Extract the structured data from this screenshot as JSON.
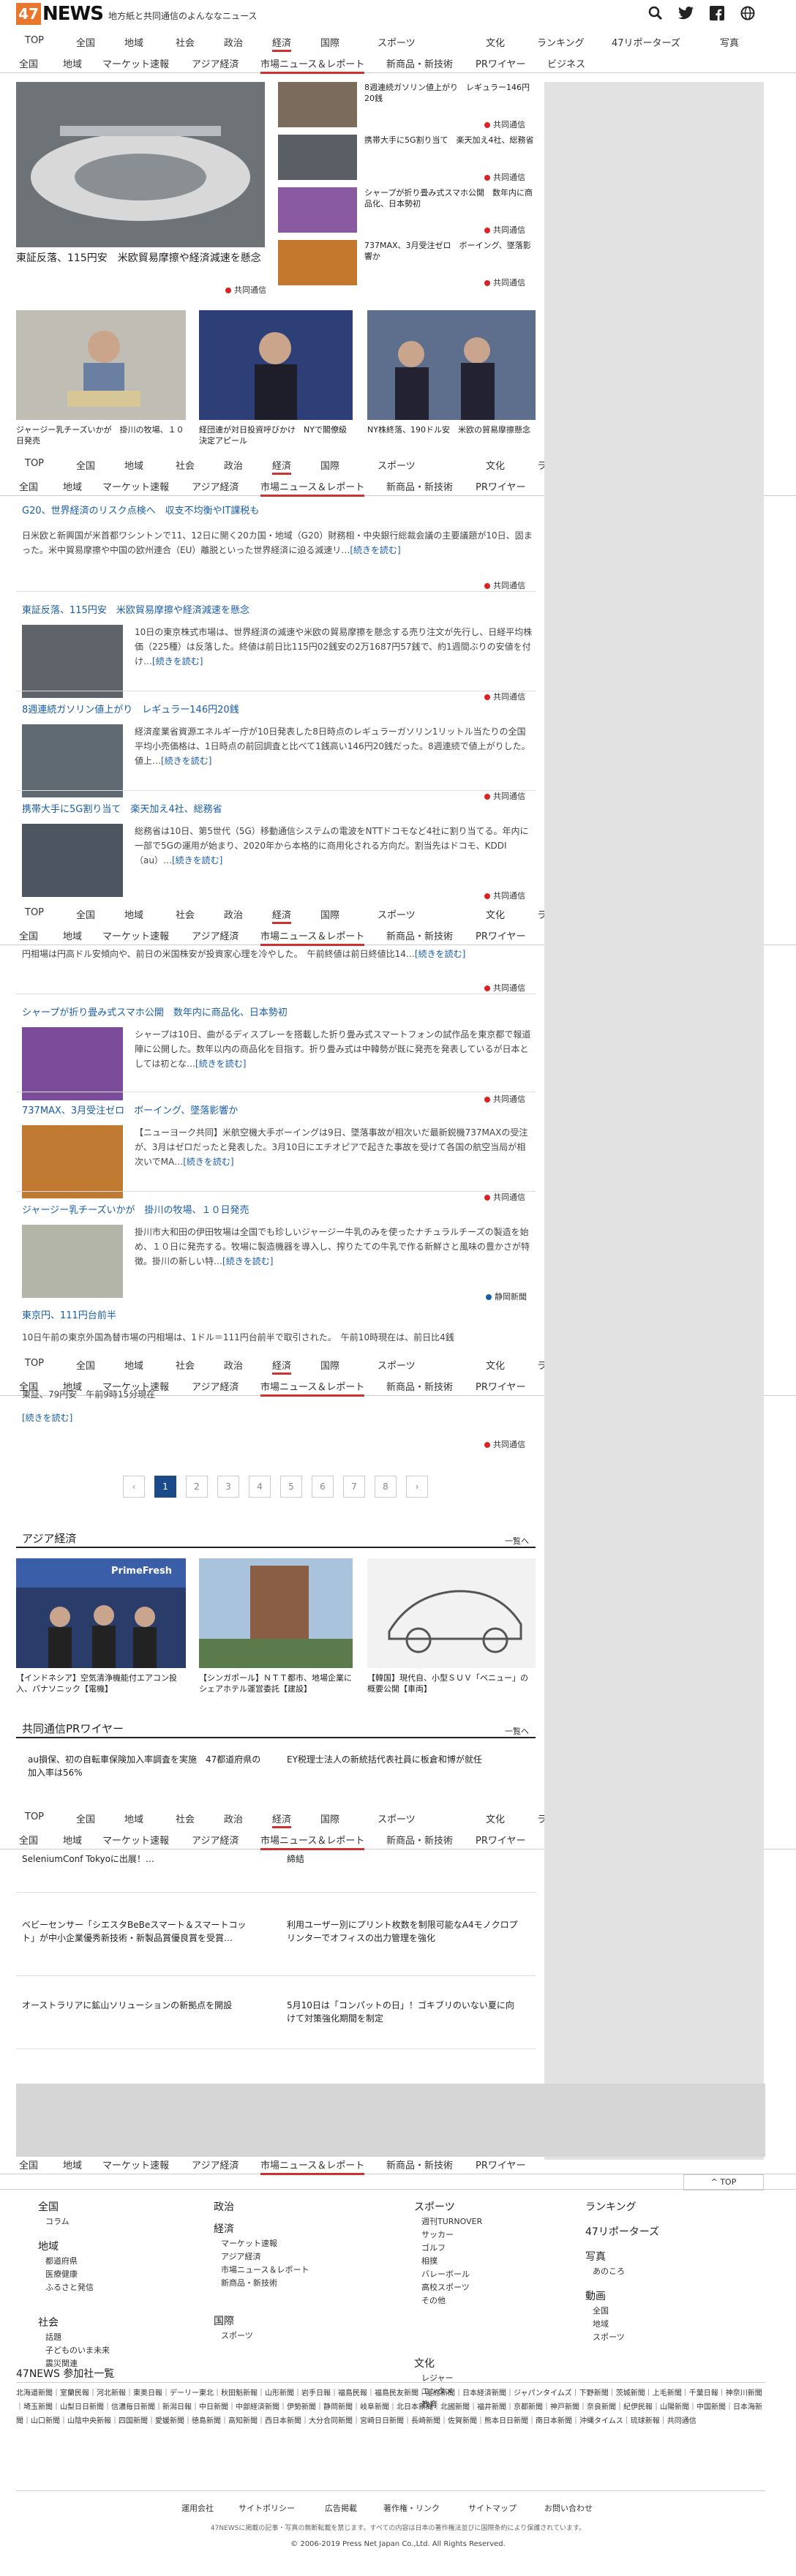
{
  "header": {
    "logo_mark": "47",
    "logo_text": "NEWS",
    "tagline": "地方紙と共同通信のよんななニュース"
  },
  "nav_main": [
    "TOP",
    "全国",
    "地域",
    "社会",
    "政治",
    "経済",
    "国際",
    "スポーツ",
    "文化",
    "ランキング",
    "47リポーターズ",
    "写真"
  ],
  "nav_sub": [
    "全国",
    "地域",
    "マーケット速報",
    "アジア経済",
    "市場ニュース＆レポート",
    "新商品・新技術",
    "PRワイヤー",
    "ビジネス"
  ],
  "hero": {
    "caption": "東証反落、115円安　米欧貿易摩擦や経済減速を懸念",
    "source": "共同通信"
  },
  "side_news": [
    {
      "title": "8週連続ガソリン値上がり　レギュラー146円20銭",
      "source": "共同通信"
    },
    {
      "title": "携帯大手に5G割り当て　楽天加え4社、総務省",
      "source": "共同通信"
    },
    {
      "title": "シャープが折り畳み式スマホ公開　数年内に商品化、日本勢初",
      "source": "共同通信"
    },
    {
      "title": "737MAX、3月受注ゼロ　ボーイング、墜落影響か",
      "source": "共同通信"
    }
  ],
  "photo_row": [
    {
      "caption": "ジャージー乳チーズいかが　掛川の牧場、１０日発売"
    },
    {
      "caption": "経団連が対日投資呼びかけ　NYで閣僚級決定アピール"
    },
    {
      "caption": "NY株終落、190ドル安　米欧の貿易摩擦懸念"
    }
  ],
  "lead": {
    "title": "G20、世界経済のリスク点検へ　収支不均衡やIT課税も",
    "body": "日米欧と新興国が米首都ワシントンで11、12日に開く20カ国・地域（G20）財務相・中央銀行総裁会議の主要議題が10日、固まった。米中貿易摩擦や中国の欧州連合（EU）離脱といった世界経済に迫る減速リ…",
    "more": "[続きを読む]",
    "source": "共同通信"
  },
  "articles": [
    {
      "title": "東証反落、115円安　米欧貿易摩擦や経済減速を懸念",
      "body": "10日の東京株式市場は、世界経済の減速や米欧の貿易摩擦を懸念する売り注文が先行し、日経平均株価（225種）は反落した。終値は前日比115円02銭安の2万1687円57銭で、約1週間ぶりの安値を付け…",
      "more": "[続きを読む]",
      "source": "共同通信"
    },
    {
      "title": "8週連続ガソリン値上がり　レギュラー146円20銭",
      "body": "経済産業省資源エネルギー庁が10日発表した8日時点のレギュラーガソリン1リットル当たりの全国平均小売価格は、1日時点の前回調査と比べて1銭高い146円20銭だった。8週連続で値上がりした。値上…",
      "more": "[続きを読む]",
      "source": "共同通信"
    },
    {
      "title": "携帯大手に5G割り当て　楽天加え4社、総務省",
      "body": "総務省は10日、第5世代（5G）移動通信システムの電波をNTTドコモなど4社に割り当てる。年内に一部で5Gの運用が始まり、2020年から本格的に商用化される方向だ。割当先はドコモ、KDDI（au）…",
      "more": "[続きを読む]",
      "source": "共同通信"
    }
  ],
  "partial_top": {
    "body": "円相場は円高ドル安傾向や、前日の米国株安が投資家心理を冷やした。　午前終値は前日終値比14…",
    "more": "[続きを読む]",
    "source": "共同通信"
  },
  "articles2": [
    {
      "title": "シャープが折り畳み式スマホ公開　数年内に商品化、日本勢初",
      "body": "シャープは10日、曲がるディスプレーを搭載した折り畳み式スマートフォンの試作品を東京都で報道陣に公開した。数年以内の商品化を目指す。折り畳み式は中韓勢が既に発売を発表しているが日本としては初とな…",
      "more": "[続きを読む]",
      "source": "共同通信"
    },
    {
      "title": "737MAX、3月受注ゼロ　ボーイング、墜落影響か",
      "body": "【ニューヨーク共同】米航空機大手ボーイングは9日、墜落事故が相次いだ最新鋭機737MAXの受注が、3月はゼロだったと発表した。3月10日にエチオピアで起きた事故を受けて各国の航空当局が相次いでMA…",
      "more": "[続きを読む]",
      "source": "共同通信"
    },
    {
      "title": "ジャージー乳チーズいかが　掛川の牧場、１０日発売",
      "body": "掛川市大和田の伊田牧場は全国でも珍しいジャージー牛乳のみを使ったナチュラルチーズの製造を始め、１０日に発売する。牧場に製造機器を導入し、搾りたての牛乳で作る新鮮さと風味の豊かさが特徴。掛川の新しい特…",
      "more": "[続きを読む]",
      "source": "静岡新聞"
    }
  ],
  "last_article": {
    "title": "東京円、111円台前半",
    "body": "10日午前の東京外国為替市場の円相場は、1ドル＝111円台前半で取引された。　午前10時現在は、前日比4銭",
    "partial": "東証、79円安　午前9時15分現在",
    "more": "[続きを読む]",
    "source": "共同通信"
  },
  "pagination": [
    "‹",
    "1",
    "2",
    "3",
    "4",
    "5",
    "6",
    "7",
    "8",
    "›"
  ],
  "asia": {
    "heading": "アジア経済",
    "list_link": "一覧へ",
    "items": [
      {
        "caption": "【インドネシア】空気清浄機能付エアコン投入、パナソニック【電機】"
      },
      {
        "caption": "【シンガポール】ＮＴＴ都市、地場企業にシェアホテル運営委託【建設】"
      },
      {
        "caption": "【韓国】現代自、小型ＳＵＶ「ベニュー」の概要公開【車両】"
      }
    ],
    "thumb_label": "PrimeFresh"
  },
  "pr": {
    "heading": "共同通信PRワイヤー",
    "list_link": "一覧へ",
    "items": [
      "au損保、初の自転車保険加入率調査を実施　47都道府県の加入率は56%",
      "EY税理士法人の新統括代表社員に板倉和博が就任",
      "SeleniumConf Tokyoに出展！…",
      "締結",
      "ベビーセンサー「シエスタBeBeスマート＆スマートコット」が中小企業優秀新技術・新製品賞優良賞を受賞…",
      "利用ユーザー別にプリント枚数を制限可能なA4モノクロプリンターでオフィスの出力管理を強化",
      "オーストラリアに鉱山ソリューションの新拠点を開設",
      "5月10日は「コンパットの日」！ゴキブリのいない夏に向けて対策強化期間を制定"
    ]
  },
  "top_link": "^ TOP",
  "footer": {
    "cols": [
      {
        "head": "全国",
        "items": [
          "コラム"
        ]
      },
      {
        "head": "地域",
        "items": [
          "都道府県",
          "医療健康",
          "ふるさと発信"
        ]
      },
      {
        "head": "社会",
        "items": [
          "話題",
          "子どものいま未来",
          "震災関連"
        ]
      },
      {
        "head": "政治",
        "items": []
      },
      {
        "head": "経済",
        "items": [
          "マーケット速報",
          "アジア経済",
          "市場ニュース＆レポート",
          "新商品・新技術"
        ]
      },
      {
        "head": "国際",
        "items": [
          "スポーツ"
        ]
      },
      {
        "head": "スポーツ",
        "items": [
          "週刊TURNOVER",
          "サッカー",
          "ゴルフ",
          "相撲",
          "バレーボール",
          "高校スポーツ",
          "その他"
        ]
      },
      {
        "head": "文化",
        "items": [
          "レジャー",
          "エンタメ",
          "教育"
        ]
      },
      {
        "head": "ランキング",
        "items": []
      },
      {
        "head": "47リポーターズ",
        "items": []
      },
      {
        "head": "写真",
        "items": [
          "あのころ"
        ]
      },
      {
        "head": "動画",
        "items": [
          "全国",
          "地域",
          "スポーツ"
        ]
      }
    ],
    "members_title": "47NEWS 参加社一覧",
    "members": "北海道新聞｜室蘭民報｜河北新報｜東奥日報｜デーリー東北｜秋田魁新報｜山形新聞｜岩手日報｜福島民報｜福島民友新聞｜産経新聞｜日本経済新聞｜ジャパンタイムズ｜下野新聞｜茨城新聞｜上毛新聞｜千葉日報｜神奈川新聞｜埼玉新聞｜山梨日日新聞｜信濃毎日新聞｜新潟日報｜中日新聞｜中部経済新聞｜伊勢新聞｜静岡新聞｜岐阜新聞｜北日本新聞｜北國新聞｜福井新聞｜京都新聞｜神戸新聞｜奈良新聞｜紀伊民報｜山陽新聞｜中国新聞｜日本海新聞｜山口新聞｜山陰中央新報｜四国新聞｜愛媛新聞｜徳島新聞｜高知新聞｜西日本新聞｜大分合同新聞｜宮崎日日新聞｜長崎新聞｜佐賀新聞｜熊本日日新聞｜南日本新聞｜沖縄タイムス｜琉球新報｜共同通信",
    "links": [
      "運用会社",
      "サイトポリシー",
      "広告掲載",
      "著作権・リンク",
      "サイトマップ",
      "お問い合わせ"
    ],
    "notice": "47NEWSに掲載の記事・写真の無断転載を禁じます。すべての内容は日本の著作権法並びに国際条約により保護されています。",
    "copyright": "© 2006-2019 Press Net Japan Co.,Ltd. All Rights Reserved."
  }
}
